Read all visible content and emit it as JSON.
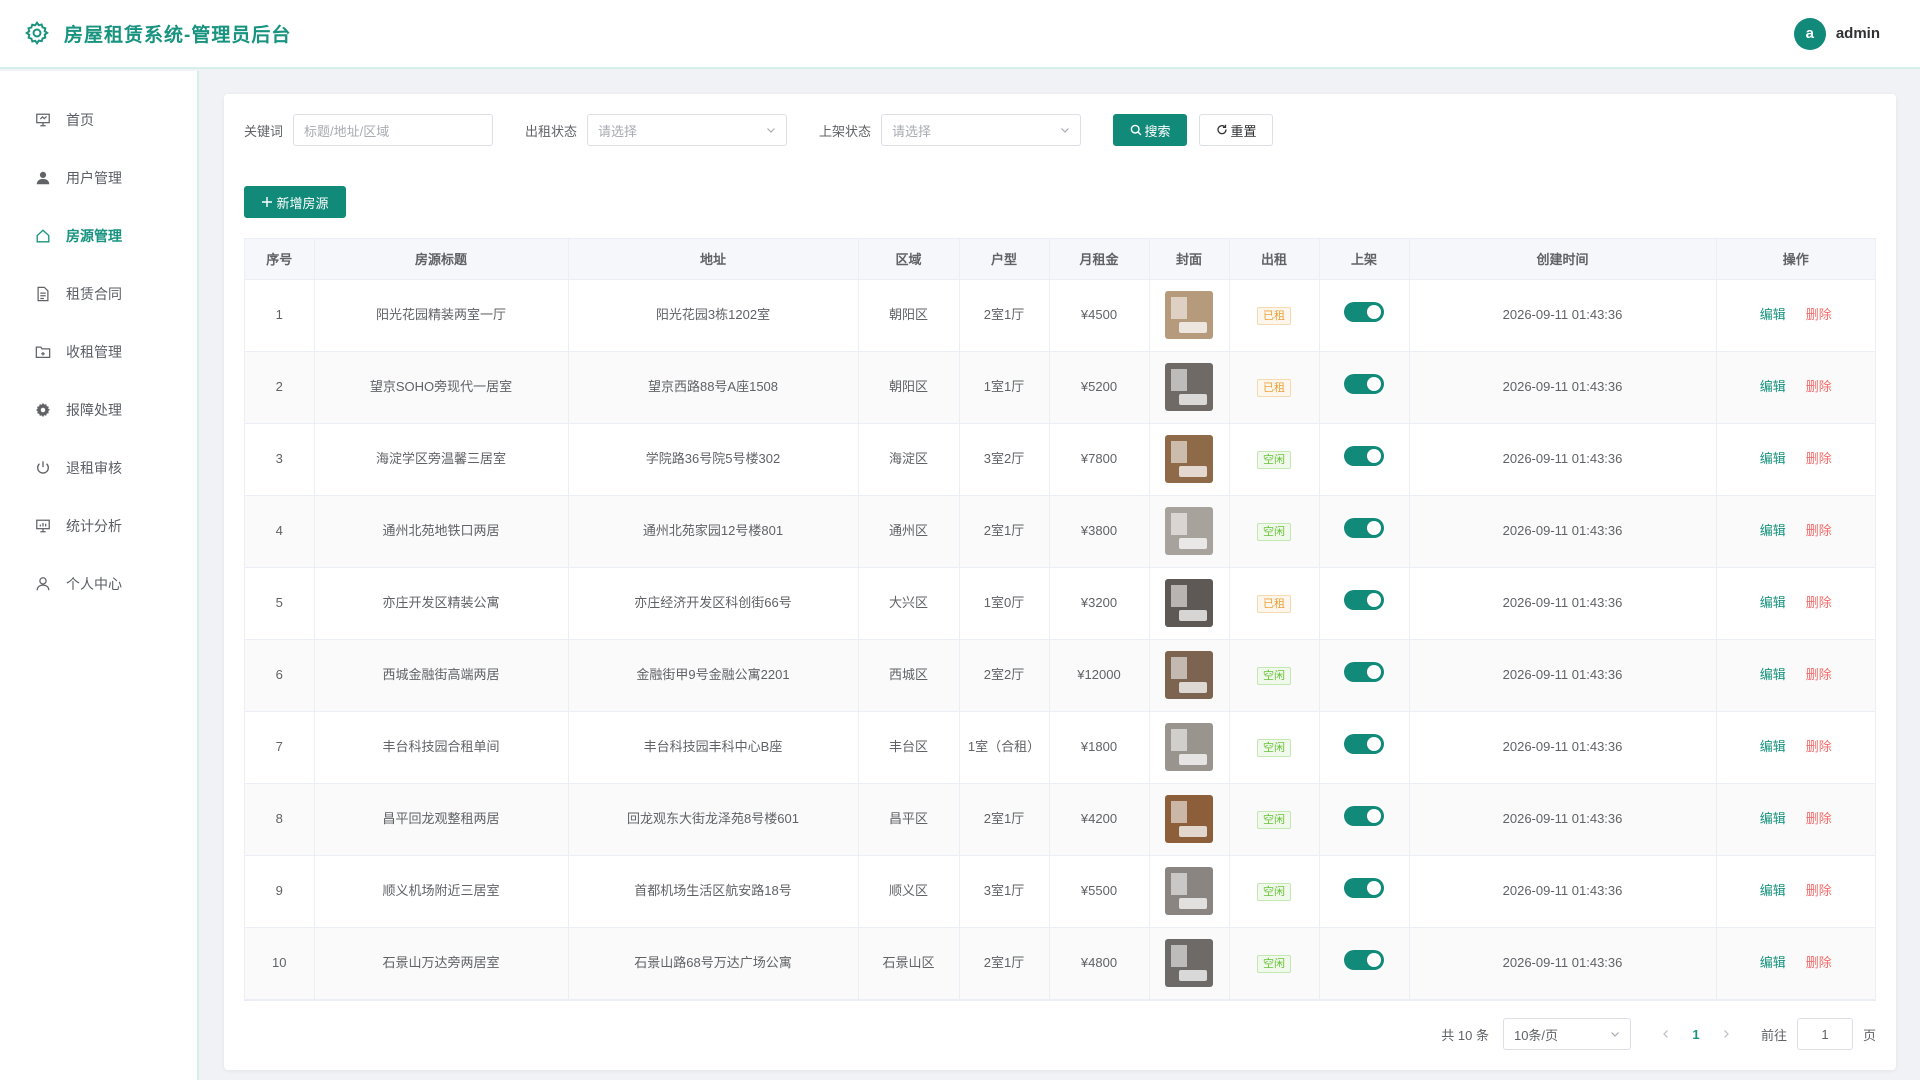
{
  "header": {
    "title": "房屋租赁系统-管理员后台",
    "avatar_letter": "a",
    "user_name": "admin"
  },
  "sidebar": {
    "items": [
      {
        "label": "首页",
        "icon": "presentation-icon",
        "active": false
      },
      {
        "label": "用户管理",
        "icon": "user-filled-icon",
        "active": false
      },
      {
        "label": "房源管理",
        "icon": "house-icon",
        "active": true
      },
      {
        "label": "租赁合同",
        "icon": "document-icon",
        "active": false
      },
      {
        "label": "收租管理",
        "icon": "folder-icon",
        "active": false
      },
      {
        "label": "报障处理",
        "icon": "gear-icon",
        "active": false
      },
      {
        "label": "退租审核",
        "icon": "power-icon",
        "active": false
      },
      {
        "label": "统计分析",
        "icon": "chart-board-icon",
        "active": false
      },
      {
        "label": "个人中心",
        "icon": "user-icon",
        "active": false
      }
    ]
  },
  "filters": {
    "keyword_label": "关键词",
    "keyword_placeholder": "标题/地址/区域",
    "rent_status_label": "出租状态",
    "rent_status_placeholder": "请选择",
    "shelf_status_label": "上架状态",
    "shelf_status_placeholder": "请选择",
    "search_label": "搜索",
    "reset_label": "重置"
  },
  "add_button_label": "新增房源",
  "table": {
    "columns": [
      "序号",
      "房源标题",
      "地址",
      "区域",
      "户型",
      "月租金",
      "封面",
      "出租",
      "上架",
      "创建时间",
      "操作"
    ],
    "edit_label": "编辑",
    "delete_label": "删除",
    "rows": [
      {
        "no": "1",
        "title": "阳光花园精装两室一厅",
        "address": "阳光花园3栋1202室",
        "district": "朝阳区",
        "layout": "2室1厅",
        "rent": "¥4500",
        "status": "已租",
        "rented": true,
        "on_shelf": true,
        "created": "2026-09-11 01:43:36",
        "cover_color": "#b59a7c"
      },
      {
        "no": "2",
        "title": "望京SOHO旁现代一居室",
        "address": "望京西路88号A座1508",
        "district": "朝阳区",
        "layout": "1室1厅",
        "rent": "¥5200",
        "status": "已租",
        "rented": true,
        "on_shelf": true,
        "created": "2026-09-11 01:43:36",
        "cover_color": "#6f6a66"
      },
      {
        "no": "3",
        "title": "海淀学区旁温馨三居室",
        "address": "学院路36号院5号楼302",
        "district": "海淀区",
        "layout": "3室2厅",
        "rent": "¥7800",
        "status": "空闲",
        "rented": false,
        "on_shelf": true,
        "created": "2026-09-11 01:43:36",
        "cover_color": "#8f6a48"
      },
      {
        "no": "4",
        "title": "通州北苑地铁口两居",
        "address": "通州北苑家园12号楼801",
        "district": "通州区",
        "layout": "2室1厅",
        "rent": "¥3800",
        "status": "空闲",
        "rented": false,
        "on_shelf": true,
        "created": "2026-09-11 01:43:36",
        "cover_color": "#a8a29c"
      },
      {
        "no": "5",
        "title": "亦庄开发区精装公寓",
        "address": "亦庄经济开发区科创街66号",
        "district": "大兴区",
        "layout": "1室0厅",
        "rent": "¥3200",
        "status": "已租",
        "rented": true,
        "on_shelf": true,
        "created": "2026-09-11 01:43:36",
        "cover_color": "#5f5955"
      },
      {
        "no": "6",
        "title": "西城金融街高端两居",
        "address": "金融街甲9号金融公寓2201",
        "district": "西城区",
        "layout": "2室2厅",
        "rent": "¥12000",
        "status": "空闲",
        "rented": false,
        "on_shelf": true,
        "created": "2026-09-11 01:43:36",
        "cover_color": "#7d6450"
      },
      {
        "no": "7",
        "title": "丰台科技园合租单间",
        "address": "丰台科技园丰科中心B座",
        "district": "丰台区",
        "layout": "1室（合租）",
        "rent": "¥1800",
        "status": "空闲",
        "rented": false,
        "on_shelf": true,
        "created": "2026-09-11 01:43:36",
        "cover_color": "#9a948e"
      },
      {
        "no": "8",
        "title": "昌平回龙观整租两居",
        "address": "回龙观东大街龙泽苑8号楼601",
        "district": "昌平区",
        "layout": "2室1厅",
        "rent": "¥4200",
        "status": "空闲",
        "rented": false,
        "on_shelf": true,
        "created": "2026-09-11 01:43:36",
        "cover_color": "#8c5f3a"
      },
      {
        "no": "9",
        "title": "顺义机场附近三居室",
        "address": "首都机场生活区航安路18号",
        "district": "顺义区",
        "layout": "3室1厅",
        "rent": "¥5500",
        "status": "空闲",
        "rented": false,
        "on_shelf": true,
        "created": "2026-09-11 01:43:36",
        "cover_color": "#8a8580"
      },
      {
        "no": "10",
        "title": "石景山万达旁两居室",
        "address": "石景山路68号万达广场公寓",
        "district": "石景山区",
        "layout": "2室1厅",
        "rent": "¥4800",
        "status": "空闲",
        "rented": false,
        "on_shelf": true,
        "created": "2026-09-11 01:43:36",
        "cover_color": "#6e6a68"
      }
    ]
  },
  "pagination": {
    "total_text": "共 10 条",
    "page_size": "10条/页",
    "current_page": "1",
    "goto_label": "前往",
    "goto_value": "1",
    "page_suffix": "页"
  },
  "colors": {
    "primary": "#128a79",
    "danger": "#f56c6c",
    "rented_tag": "#e6a23c",
    "free_tag": "#67c23a"
  }
}
